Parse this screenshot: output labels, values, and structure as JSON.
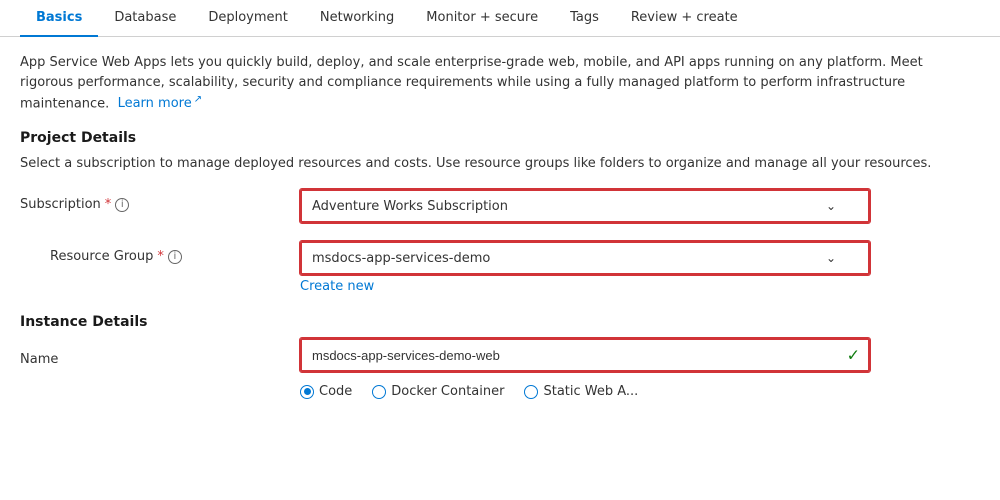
{
  "tabs": [
    {
      "id": "basics",
      "label": "Basics",
      "active": true
    },
    {
      "id": "database",
      "label": "Database",
      "active": false
    },
    {
      "id": "deployment",
      "label": "Deployment",
      "active": false
    },
    {
      "id": "networking",
      "label": "Networking",
      "active": false
    },
    {
      "id": "monitor",
      "label": "Monitor + secure",
      "active": false
    },
    {
      "id": "tags",
      "label": "Tags",
      "active": false
    },
    {
      "id": "review",
      "label": "Review + create",
      "active": false
    }
  ],
  "description": {
    "text": "App Service Web Apps lets you quickly build, deploy, and scale enterprise-grade web, mobile, and API apps running on any platform. Meet rigorous performance, scalability, security and compliance requirements while using a fully managed platform to perform infrastructure maintenance.",
    "learn_more": "Learn more",
    "learn_more_icon": "↗"
  },
  "project_details": {
    "title": "Project Details",
    "description": "Select a subscription to manage deployed resources and costs. Use resource groups like folders to organize and manage all your resources.",
    "subscription": {
      "label": "Subscription",
      "required": "*",
      "info": "i",
      "value": "Adventure Works Subscription",
      "options": [
        "Adventure Works Subscription"
      ]
    },
    "resource_group": {
      "label": "Resource Group",
      "required": "*",
      "info": "i",
      "value": "msdocs-app-services-demo",
      "options": [
        "msdocs-app-services-demo"
      ],
      "create_new": "Create new"
    }
  },
  "instance_details": {
    "title": "Instance Details",
    "name": {
      "label": "Name",
      "value": "msdocs-app-services-demo-web",
      "check_icon": "✓"
    },
    "publish_options": [
      {
        "label": "Code",
        "selected": true
      },
      {
        "label": "Docker Container",
        "selected": false
      },
      {
        "label": "Static Web A...",
        "selected": false
      }
    ]
  },
  "colors": {
    "accent": "#0078d4",
    "required": "#d13438",
    "success": "#107c10",
    "tab_active": "#0078d4"
  }
}
